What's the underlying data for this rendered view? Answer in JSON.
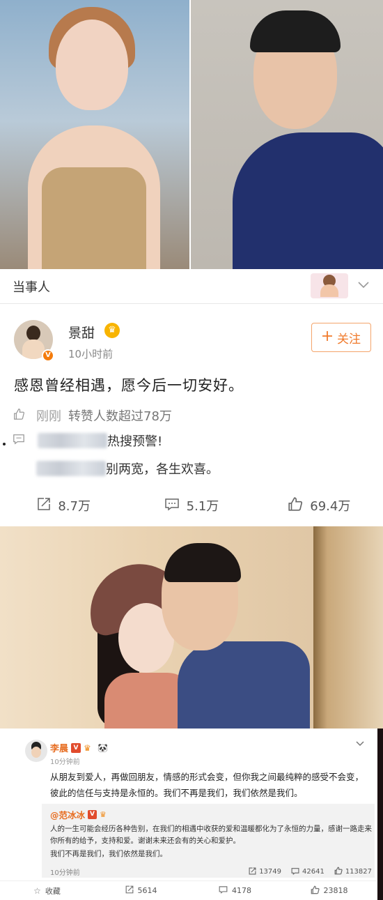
{
  "header": {
    "section_title": "当事人"
  },
  "post1": {
    "username": "景甜",
    "time": "10小时前",
    "follow_label": "关注",
    "content": "感恩曾经相遇，愿今后一切安好。",
    "notice1_time": "刚刚",
    "notice1_text": "转赞人数超过78万",
    "notice2_text": "热搜预警!",
    "notice3_text": "别两宽，各生欢喜。",
    "repost_count": "8.7万",
    "comment_count": "5.1万",
    "like_count": "69.4万"
  },
  "post2": {
    "username": "李晨",
    "time": "10分钟前",
    "content": "从朋友到爱人，再做回朋友，情感的形式会变，但你我之间最纯粹的感受不会变，彼此的信任与支持是永恒的。我们不再是我们，我们依然是我们。",
    "repost_user": "@范冰冰",
    "repost_content": "人的一生可能会经历各种告别，在我们的相遇中收获的爱和温暖都化为了永恒的力量，感谢一路走来你所有的给予，支持和爱。谢谢未来还会有的关心和爱护。",
    "repost_content2": "我们不再是我们，我们依然是我们。",
    "repost_time": "10分钟前",
    "repost_repost_count": "13749",
    "repost_comment_count": "42641",
    "repost_like_count": "113827",
    "fav_label": "收藏",
    "repost_count": "5614",
    "comment_count": "4178",
    "like_count": "23818"
  },
  "icons": {
    "follow": "plus-icon",
    "like": "thumbs-up-icon",
    "comment": "comment-icon",
    "repost": "share-icon",
    "favorite": "star-icon",
    "dropdown": "chevron-down-icon"
  },
  "colors": {
    "accent_orange": "#f07a2b",
    "verified_badge": "#f47c0c",
    "crown": "#f8b400"
  }
}
